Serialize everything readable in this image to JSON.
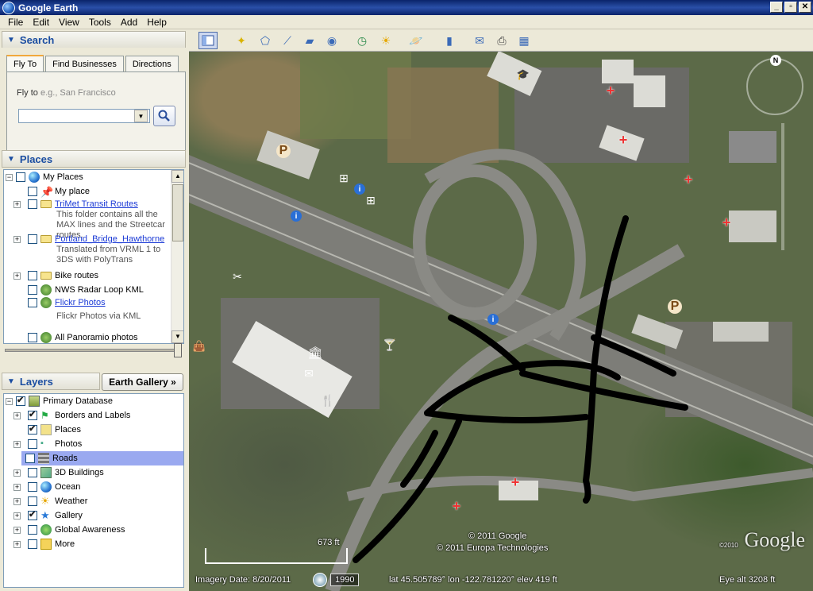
{
  "window": {
    "title": "Google Earth",
    "min": "_",
    "max": "▫",
    "close": "✕"
  },
  "menu": [
    "File",
    "Edit",
    "View",
    "Tools",
    "Add",
    "Help"
  ],
  "search": {
    "header": "Search",
    "tabs": [
      "Fly To",
      "Find Businesses",
      "Directions"
    ],
    "flyto_label": "Fly to",
    "flyto_placeholder": "e.g., San Francisco",
    "flyto_value": ""
  },
  "places": {
    "header": "Places",
    "items": [
      {
        "label": "My Places",
        "checked": false
      },
      {
        "label": "My place",
        "checked": false
      },
      {
        "label": "TriMet Transit Routes",
        "desc": "This folder contains all the MAX lines and the Streetcar routes."
      },
      {
        "label": "Portland_Bridge_Hawthorne",
        "desc1": "Translated from VRML 1 to",
        "desc2": "3DS with PolyTrans"
      },
      {
        "label": "Bike routes"
      },
      {
        "label": "NWS Radar Loop KML"
      },
      {
        "label": "Flickr Photos",
        "desc": "Flickr Photos via KML"
      },
      {
        "label": "All Panoramio photos"
      }
    ]
  },
  "layers": {
    "header": "Layers",
    "gallery_button": "Earth Gallery »",
    "items": [
      {
        "label": "Primary Database",
        "checked": true
      },
      {
        "label": "Borders and Labels",
        "checked": true
      },
      {
        "label": "Places",
        "checked": true
      },
      {
        "label": "Photos",
        "checked": false
      },
      {
        "label": "Roads",
        "checked": false,
        "selected": true
      },
      {
        "label": "3D Buildings",
        "checked": false
      },
      {
        "label": "Ocean",
        "checked": false
      },
      {
        "label": "Weather",
        "checked": false
      },
      {
        "label": "Gallery",
        "checked": true
      },
      {
        "label": "Global Awareness",
        "checked": false
      },
      {
        "label": "More",
        "checked": false
      }
    ]
  },
  "map": {
    "copyright1": "© 2011 Google",
    "copyright2": "© 2011 Europa Technologies",
    "scale_label": "673 ft",
    "imagery_date": "Imagery Date: 8/20/2011",
    "year": "1990",
    "coords": "lat   45.505789°  lon -122.781220°  elev   419 ft",
    "eye_alt": "Eye alt    3208 ft",
    "logo": "Google",
    "logo_year": "©2010",
    "compass_n": "N"
  }
}
